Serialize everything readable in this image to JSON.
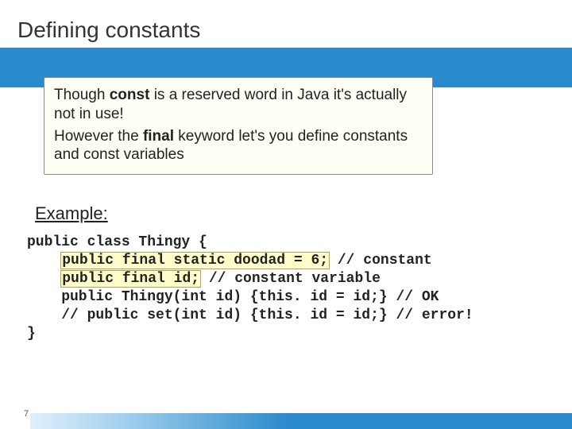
{
  "slide": {
    "title": "Defining constants",
    "callout": {
      "p1a": "Though ",
      "p1b": "const",
      "p1c": " is a reserved word in Java it's actually not in use!",
      "p2a": "However the ",
      "p2b": "final",
      "p2c": " keyword let's you define constants and const variables"
    },
    "exampleHeading": "Example:",
    "code": {
      "l1": "public class Thingy {",
      "l2a": "    ",
      "l2b": "public final static doodad = 6;",
      "l2c": " // constant",
      "l3a": "    ",
      "l3b": "public final id;",
      "l3c": " // constant variable",
      "l4": "    public Thingy(int id) {this. id = id;} // OK",
      "l5": "    // public set(int id) {this. id = id;} // error!",
      "l6": "}"
    },
    "pageNumber": "7"
  }
}
